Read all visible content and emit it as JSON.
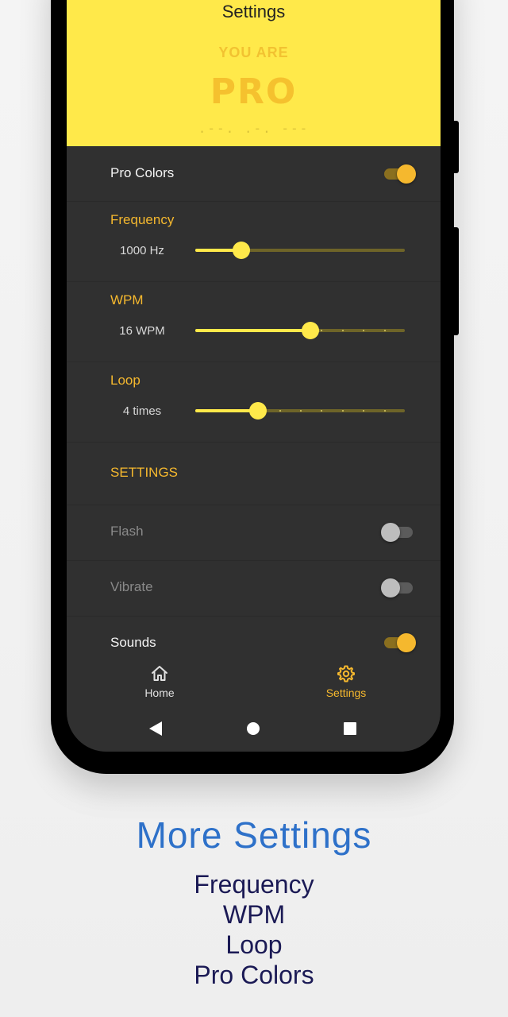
{
  "header": {
    "title": "Settings",
    "badge_line1": "YOU ARE",
    "badge_line2": "PRO",
    "morse": ".--. .-. ---"
  },
  "pro_colors": {
    "label": "Pro Colors",
    "enabled": true
  },
  "frequency": {
    "label": "Frequency",
    "value": "1000 Hz",
    "level": 0.22
  },
  "wpm": {
    "label": "WPM",
    "value": "16 WPM",
    "level": 0.55,
    "ticks": 10
  },
  "loop": {
    "label": "Loop",
    "value": "4 times",
    "level": 0.3,
    "ticks": 10
  },
  "settings_section": {
    "title": "SETTINGS"
  },
  "flash": {
    "label": "Flash",
    "enabled": false
  },
  "vibrate": {
    "label": "Vibrate",
    "enabled": false
  },
  "sounds": {
    "label": "Sounds",
    "enabled": true
  },
  "bottom_nav": {
    "home": {
      "label": "Home",
      "icon": "home-icon"
    },
    "settings": {
      "label": "Settings",
      "icon": "gear-icon",
      "active": true
    }
  },
  "colors": {
    "accent": "#f5b82e",
    "header_bg": "#ffe94a",
    "screen_bg": "#303030",
    "caption_title": "#2e71c9",
    "caption_text": "#1b1a55"
  },
  "caption": {
    "title": "More Settings",
    "lines": [
      "Frequency",
      "WPM",
      "Loop",
      "Pro Colors"
    ]
  }
}
